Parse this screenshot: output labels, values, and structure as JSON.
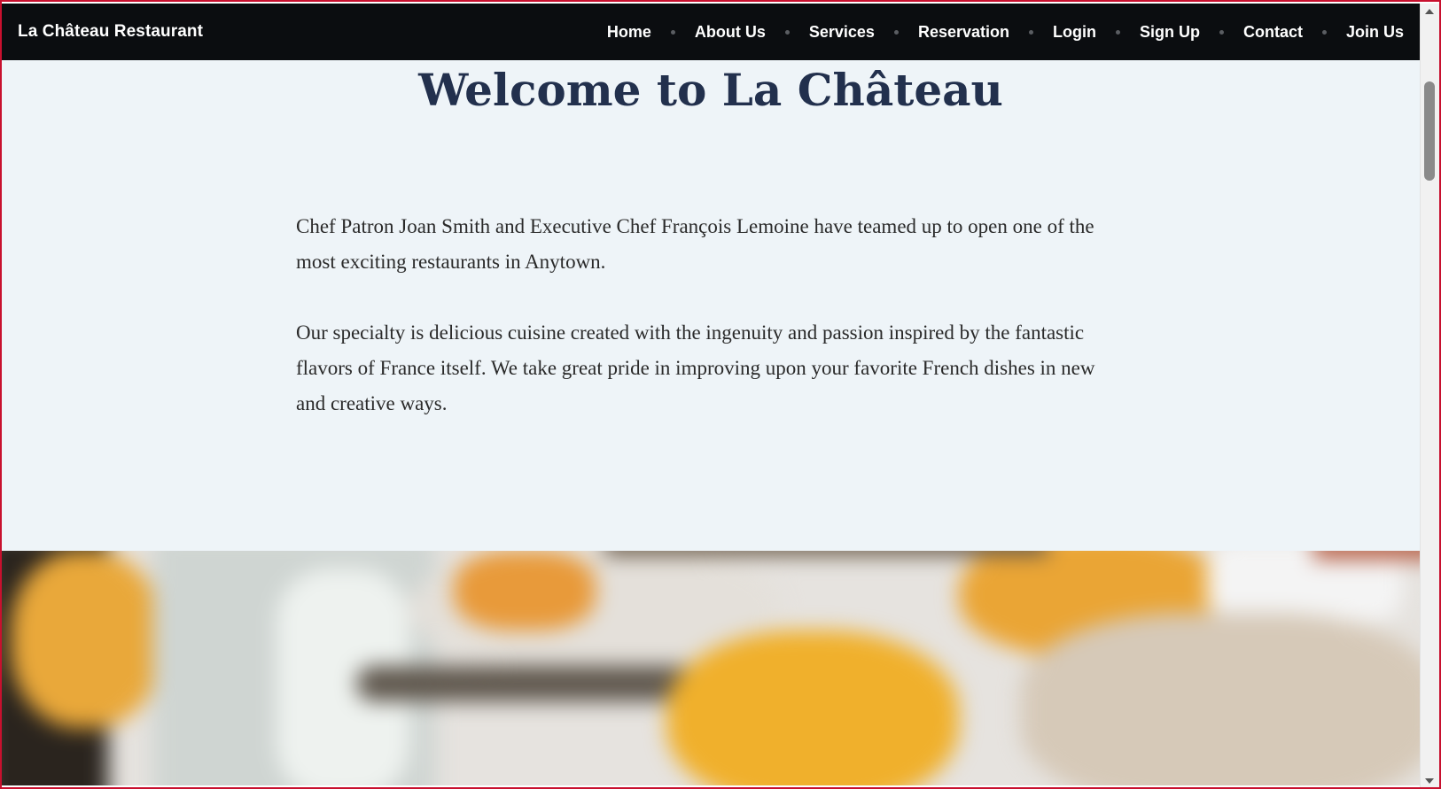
{
  "navbar": {
    "brand": "La Château Restaurant",
    "items": [
      {
        "label": "Home"
      },
      {
        "label": "About Us"
      },
      {
        "label": "Services"
      },
      {
        "label": "Reservation"
      },
      {
        "label": "Login"
      },
      {
        "label": "Sign Up"
      },
      {
        "label": "Contact"
      },
      {
        "label": "Join Us"
      }
    ]
  },
  "main": {
    "title": "Welcome to La Château",
    "paragraphs": [
      "Chef Patron Joan Smith and Executive Chef François Lemoine have teamed up to open one of the most exciting restaurants in Anytown.",
      "Our specialty is delicious cuisine created with the ingenuity and passion inspired by the fantastic flavors of France itself. We take great pride in improving upon your favorite French dishes in new and creative ways."
    ]
  },
  "colors": {
    "navbar_bg": "#0b0d10",
    "content_bg": "#eef4f8",
    "title": "#22304d",
    "window_border": "#c8102e"
  },
  "icons": {
    "nav_separator": "dot-icon",
    "scroll_up": "chevron-up-icon",
    "scroll_down": "chevron-down-icon"
  }
}
